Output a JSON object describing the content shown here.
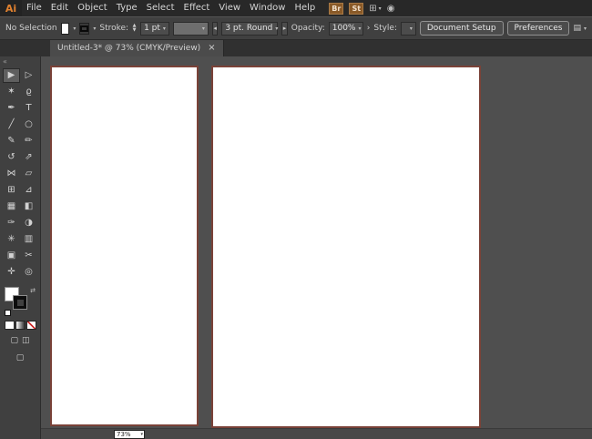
{
  "menu_bar": {
    "logo": "Ai",
    "items": [
      "File",
      "Edit",
      "Object",
      "Type",
      "Select",
      "Effect",
      "View",
      "Window",
      "Help"
    ],
    "br_label": "Br",
    "st_label": "St",
    "workspace_icon": "⊞",
    "share_icon": "◉",
    "caret": "▾"
  },
  "control_bar": {
    "selection_status": "No Selection",
    "stroke_label": "Stroke:",
    "stroke_weight": "1 pt",
    "brush_value": "3 pt. Round",
    "opacity_label": "Opacity:",
    "opacity_value": "100%",
    "style_label": "Style:",
    "document_setup_label": "Document Setup",
    "preferences_label": "Preferences",
    "panel_icon": "▤",
    "caret": "▾",
    "left_arrow": "◂",
    "right_arrow": "▸",
    "chevron": "›",
    "step_up": "▲",
    "step_down": "▼"
  },
  "document_tab": {
    "title": "Untitled-3* @ 73% (CMYK/Preview)",
    "close_glyph": "×"
  },
  "toolbar": {
    "collapse_glyph": "«",
    "swap_glyph": "⇄",
    "drawing_mode_glyphs": [
      "▢",
      "◫"
    ],
    "screen_mode_glyph": "▢",
    "tools": [
      {
        "name": "selection",
        "glyph": "▶",
        "active": true
      },
      {
        "name": "direct-selection",
        "glyph": "▷",
        "active": false
      },
      {
        "name": "magic-wand",
        "glyph": "✶",
        "active": false
      },
      {
        "name": "lasso",
        "glyph": "ϱ",
        "active": false
      },
      {
        "name": "pen",
        "glyph": "✒",
        "active": false
      },
      {
        "name": "type",
        "glyph": "T",
        "active": false
      },
      {
        "name": "line-segment",
        "glyph": "╱",
        "active": false
      },
      {
        "name": "ellipse",
        "glyph": "○",
        "active": false
      },
      {
        "name": "paintbrush",
        "glyph": "✎",
        "active": false
      },
      {
        "name": "pencil",
        "glyph": "✏",
        "active": false
      },
      {
        "name": "rotate",
        "glyph": "↺",
        "active": false
      },
      {
        "name": "scale",
        "glyph": "⇗",
        "active": false
      },
      {
        "name": "width",
        "glyph": "⋈",
        "active": false
      },
      {
        "name": "free-transform",
        "glyph": "▱",
        "active": false
      },
      {
        "name": "shape-builder",
        "glyph": "⊞",
        "active": false
      },
      {
        "name": "perspective-grid",
        "glyph": "⊿",
        "active": false
      },
      {
        "name": "mesh",
        "glyph": "▦",
        "active": false
      },
      {
        "name": "gradient",
        "glyph": "◧",
        "active": false
      },
      {
        "name": "eyedropper",
        "glyph": "✑",
        "active": false
      },
      {
        "name": "blend",
        "glyph": "◑",
        "active": false
      },
      {
        "name": "symbol-sprayer",
        "glyph": "✳",
        "active": false
      },
      {
        "name": "column-graph",
        "glyph": "▥",
        "active": false
      },
      {
        "name": "artboard",
        "glyph": "▣",
        "active": false
      },
      {
        "name": "slice",
        "glyph": "✂",
        "active": false
      },
      {
        "name": "hand",
        "glyph": "✛",
        "active": false
      },
      {
        "name": "zoom",
        "glyph": "◎",
        "active": false
      }
    ]
  },
  "status_bar": {
    "zoom_value": "73%"
  },
  "colors": {
    "accent_orange": "#e0812f",
    "artboard_border": "#7a4238",
    "canvas_bg": "#4f4f4f"
  }
}
